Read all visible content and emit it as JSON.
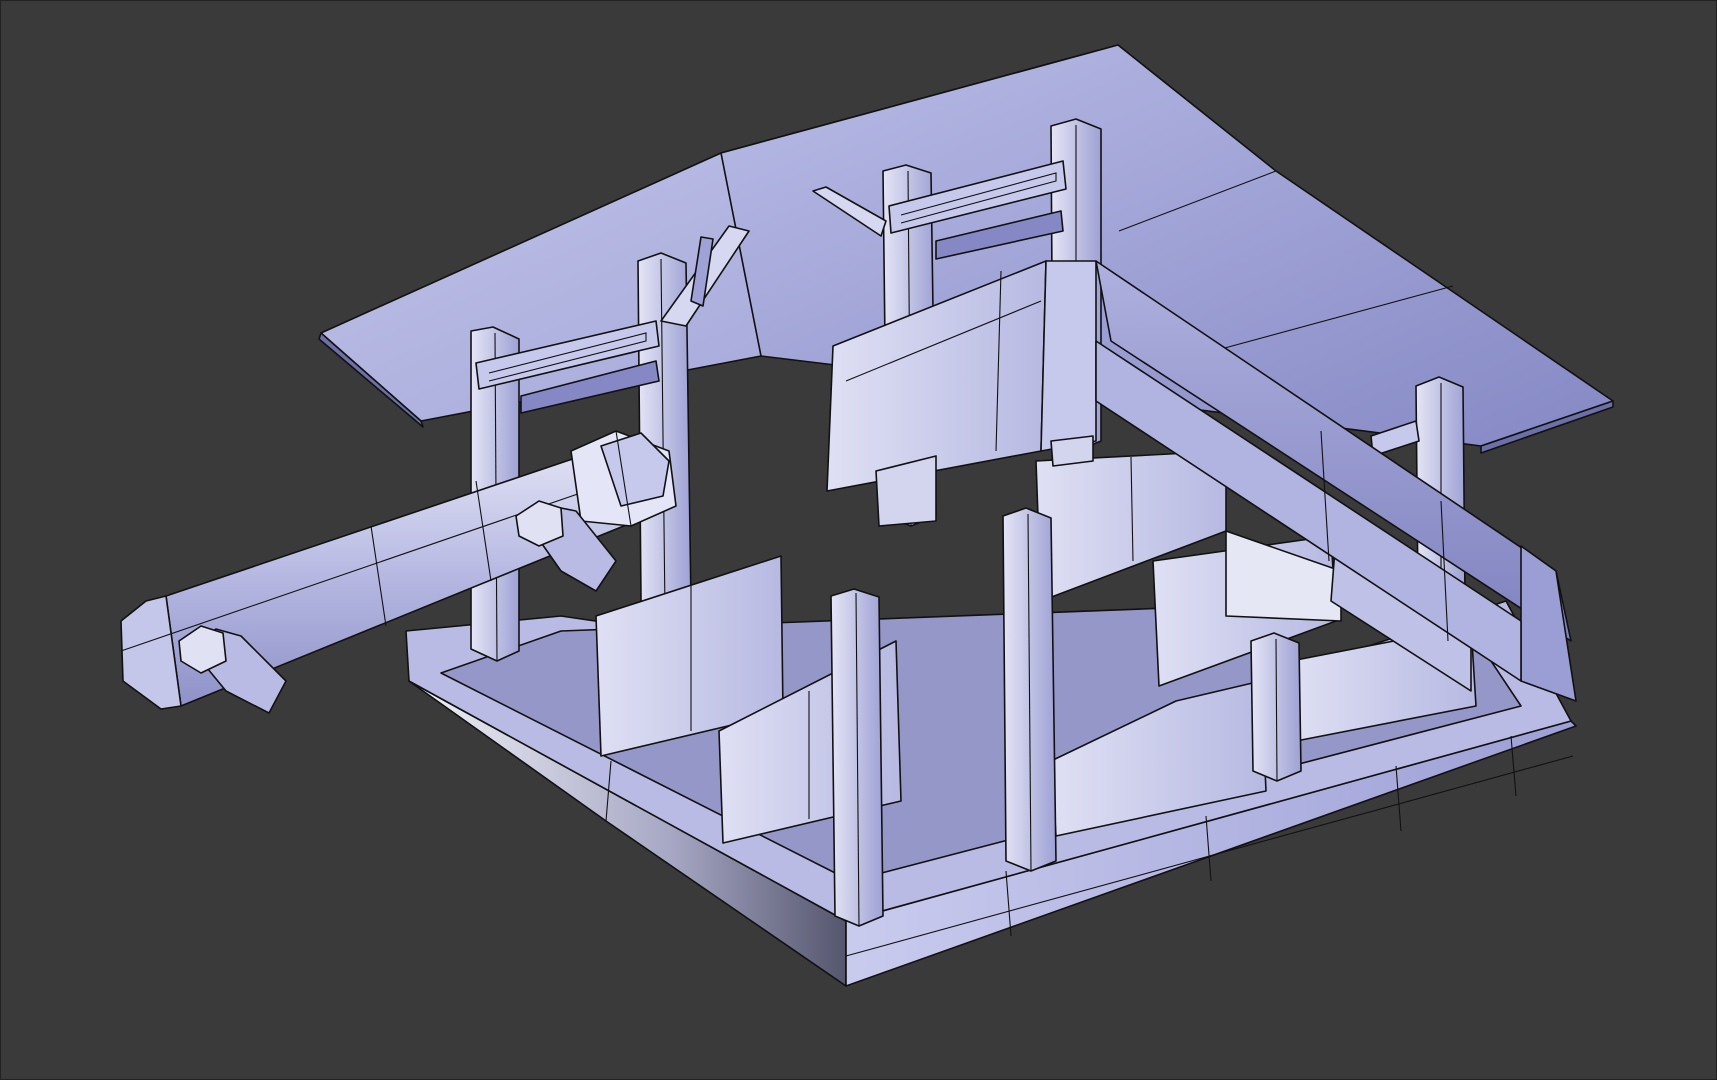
{
  "viewport": {
    "background": "#3a3a3a",
    "shading": "solid",
    "display": "wireframe-on-shaded"
  },
  "model": {
    "fill_light": "#d2d4f0",
    "fill_mid": "#a9abdc",
    "fill_dark": "#7c7fb8",
    "fill_shadow": "#4e5070"
  }
}
